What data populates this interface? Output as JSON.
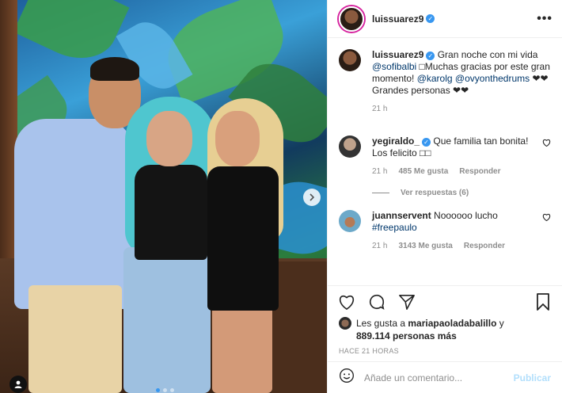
{
  "post": {
    "username": "luissuarez9",
    "more_icon": "more-horizontal-icon",
    "caption": {
      "username": "luissuarez9",
      "text_1": " Gran noche con mi vida ",
      "mention_1": "@sofibalbi",
      "text_2": " □Muchas gracias por este gran momento! ",
      "mention_2": "@karolg",
      "mention_3": "@ovyonthedrums",
      "text_3": " ❤❤ Grandes personas ❤❤",
      "time": "21 h"
    },
    "comments": [
      {
        "username": "yegiraldo_",
        "text": " Que familia tan bonita! Los felicito □□",
        "time": "21 h",
        "likes": "485 Me gusta",
        "reply": "Responder",
        "view_replies": "Ver respuestas (6)"
      },
      {
        "username": "juannservent",
        "text": " Noooooo lucho ",
        "hashtag": "#freepaulo",
        "time": "21 h",
        "likes": "3143 Me gusta",
        "reply": "Responder"
      }
    ],
    "likes": {
      "prefix": "Les gusta a ",
      "user": "mariapaoladabalillo",
      "middle": " y",
      "count": "889.114 personas más"
    },
    "timestamp": "HACE 21 HORAS",
    "add_comment": {
      "placeholder": "Añade un comentario...",
      "publish": "Publicar"
    }
  }
}
